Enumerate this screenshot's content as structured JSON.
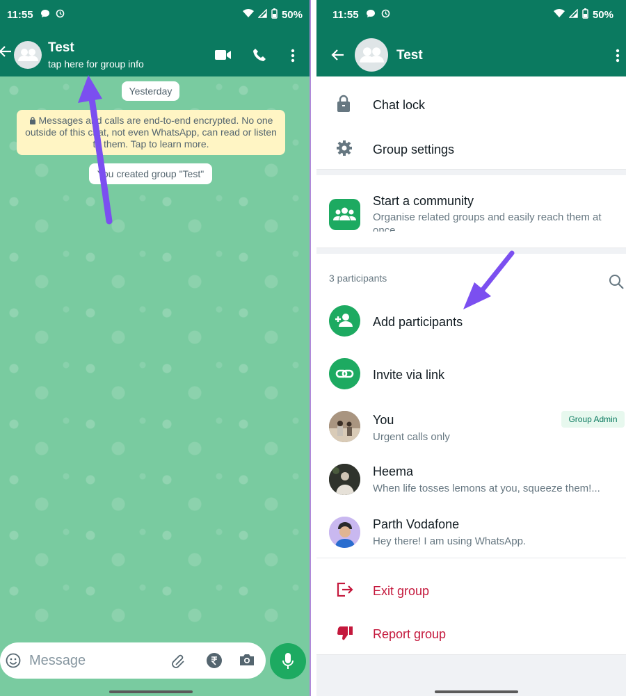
{
  "status_bar": {
    "time": "11:55",
    "battery": "50%"
  },
  "left": {
    "header": {
      "title": "Test",
      "subtitle": "tap here for group info"
    },
    "chat": {
      "date_label": "Yesterday",
      "encryption_notice": "Messages and calls are end-to-end encrypted. No one outside of this chat, not even WhatsApp, can read or listen to them. Tap to learn more.",
      "created_notice": "You created group \"Test\""
    },
    "input": {
      "placeholder": "Message"
    }
  },
  "right": {
    "header": {
      "title": "Test"
    },
    "settings": [
      {
        "label": "Chat lock",
        "icon": "lock-icon"
      },
      {
        "label": "Group settings",
        "icon": "gear-icon"
      }
    ],
    "community": {
      "title": "Start a community",
      "subtitle": "Organise related groups and easily reach them at once."
    },
    "participants_count": "3 participants",
    "actions": [
      {
        "label": "Add participants",
        "icon": "add-person-icon"
      },
      {
        "label": "Invite via link",
        "icon": "link-icon"
      }
    ],
    "participants": [
      {
        "name": "You",
        "status": "Urgent calls only",
        "badge": "Group Admin"
      },
      {
        "name": "Heema",
        "status": "When life tosses lemons at you, squeeze them!..."
      },
      {
        "name": "Parth Vodafone",
        "status": "Hey there! I am using WhatsApp."
      }
    ],
    "danger_actions": [
      {
        "label": "Exit group",
        "icon": "exit-icon"
      },
      {
        "label": "Report group",
        "icon": "thumbs-down-icon"
      }
    ]
  },
  "colors": {
    "header": "#0b7a60",
    "accent": "#1daa61",
    "chat_bg": "#79cba0",
    "danger": "#c4183c",
    "annotation_arrow": "#7b4ff0"
  }
}
